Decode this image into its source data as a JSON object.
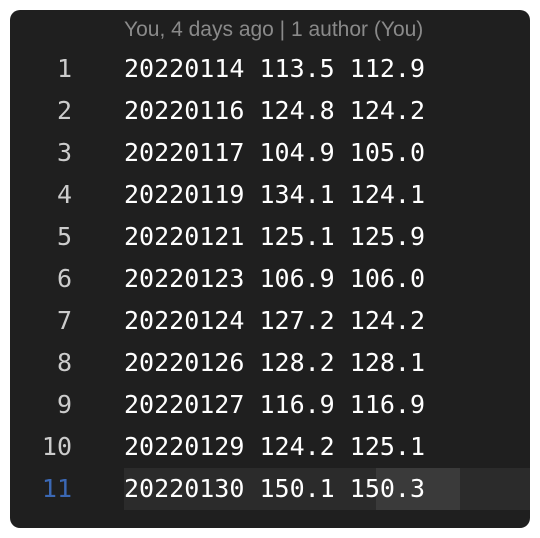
{
  "editor": {
    "blame": "You, 4 days ago | 1 author (You)",
    "current_line": "11",
    "lines": [
      {
        "number": "1",
        "text": "20220114 113.5 112.9"
      },
      {
        "number": "2",
        "text": "20220116 124.8 124.2"
      },
      {
        "number": "3",
        "text": "20220117 104.9 105.0"
      },
      {
        "number": "4",
        "text": "20220119 134.1 124.1"
      },
      {
        "number": "5",
        "text": "20220121 125.1 125.9"
      },
      {
        "number": "6",
        "text": "20220123 106.9 106.0"
      },
      {
        "number": "7",
        "text": "20220124 127.2 124.2"
      },
      {
        "number": "8",
        "text": "20220126 128.2 128.1"
      },
      {
        "number": "9",
        "text": "20220127 116.9 116.9"
      },
      {
        "number": "10",
        "text": "20220129 124.2 125.1"
      },
      {
        "number": "11",
        "text": "20220130 150.1 150.3"
      }
    ]
  },
  "colors": {
    "background": "#1f1f1f",
    "text": "#ffffff",
    "line_number": "#cccccc",
    "active_line_number": "#3b68b4",
    "codelens": "#8a8a8a"
  }
}
